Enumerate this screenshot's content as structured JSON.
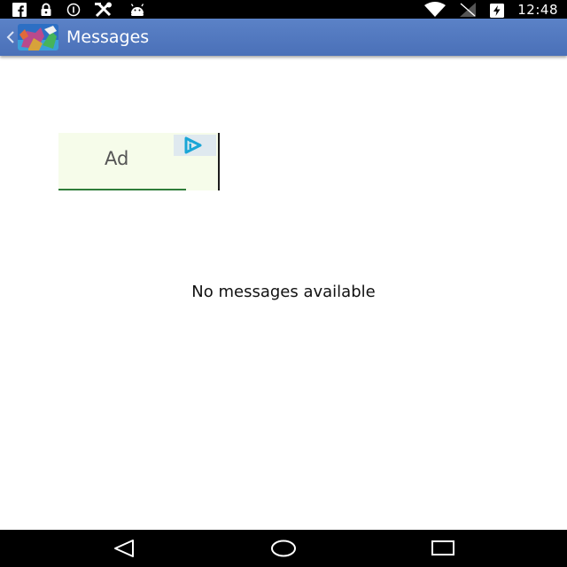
{
  "status_bar": {
    "time": "12:48",
    "left_icons": [
      "facebook-icon",
      "lock-icon",
      "data-saver-icon",
      "tools-icon",
      "android-icon"
    ],
    "right_icons": [
      "wifi-icon",
      "signal-icon",
      "battery-charging-icon"
    ]
  },
  "action_bar": {
    "title": "Messages",
    "background_color": "#5b82c7"
  },
  "ad_banner": {
    "label": "Ad",
    "choices_icon": "ad-choices-icon"
  },
  "main": {
    "empty_text": "No messages available"
  },
  "nav_bar": {
    "buttons": [
      "back-icon",
      "home-icon",
      "recents-icon"
    ]
  }
}
